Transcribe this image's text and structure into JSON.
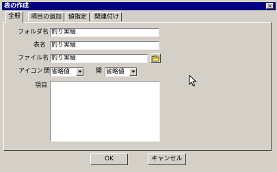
{
  "window": {
    "title": "表の作成",
    "close_glyph": "×"
  },
  "tabs": [
    {
      "label": "全般"
    },
    {
      "label": "項目の追加"
    },
    {
      "label": "値指定"
    },
    {
      "label": "関連付け"
    }
  ],
  "general": {
    "folder_label": "フォルダ名",
    "folder_value": "釣り実績",
    "table_label": "表名",
    "table_value": "釣り実績",
    "file_label": "ファイル名",
    "file_value": "釣り実績",
    "icon_label": "アイコン",
    "icon_closed_label": "閉",
    "icon_closed_value": "省略値",
    "icon_open_label": "開",
    "icon_open_value": "省略値",
    "items_label": "項目"
  },
  "buttons": {
    "ok": "OK",
    "cancel": "キャンセル"
  },
  "icons": {
    "close": "close-icon",
    "folder": "folder-open-icon",
    "cursor": "mouse-pointer-icon",
    "dropdown": "chevron-down-icon"
  }
}
